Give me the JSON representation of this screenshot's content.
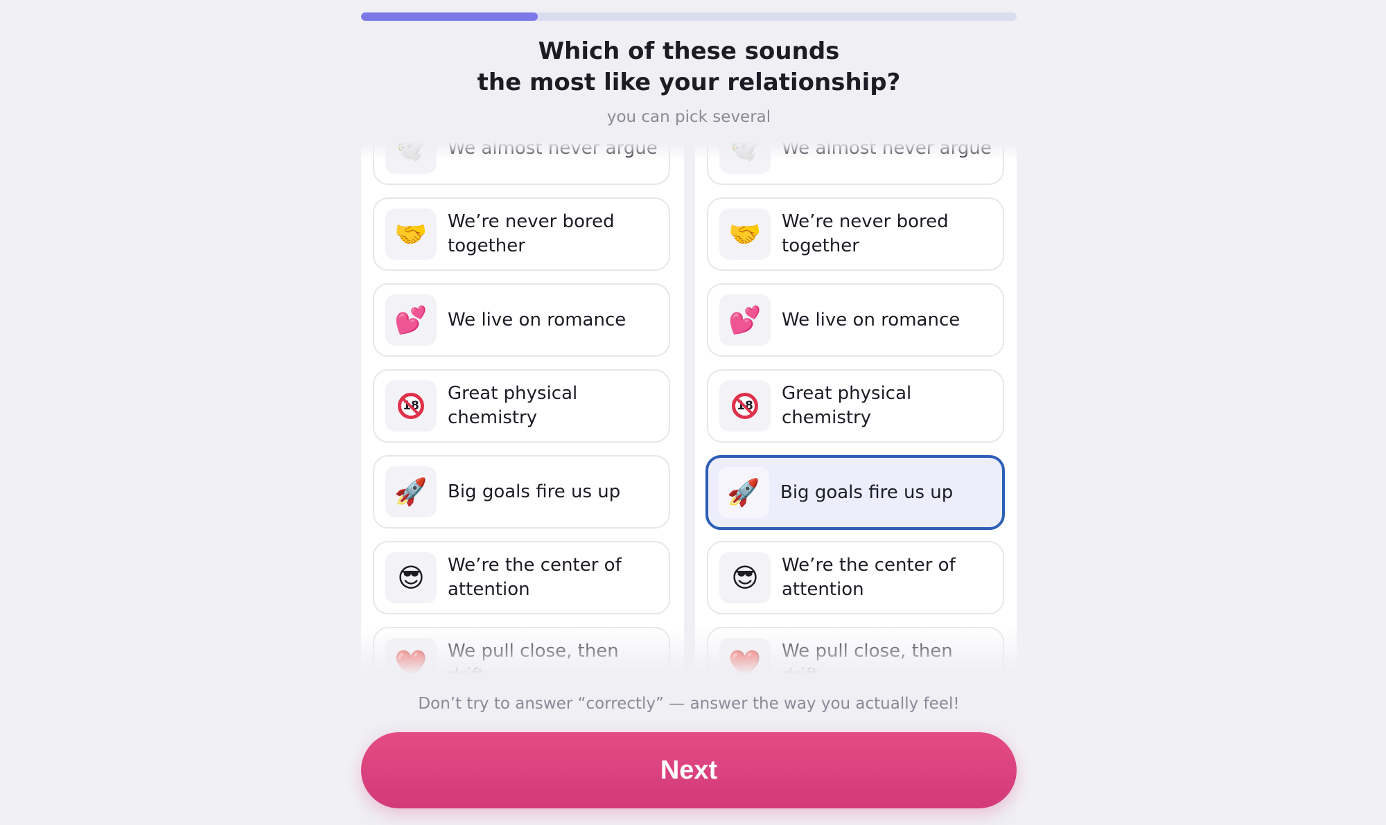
{
  "progress": {
    "fraction": 0.27,
    "fill_color": "#7b78e8",
    "track_color": "#dcdcf1"
  },
  "question": {
    "title_line1": "Which of these sounds",
    "title_line2": "the most like your relationship?",
    "subtitle": "you can pick several"
  },
  "columns": [
    {
      "options": [
        {
          "icon": "dove-icon",
          "glyph": "🕊️",
          "label": "We almost never argue",
          "selected": false
        },
        {
          "icon": "handshake-icon",
          "glyph": "🤝",
          "label": "We’re never bored together",
          "selected": false
        },
        {
          "icon": "two-hearts-icon",
          "glyph": "💕",
          "label": "We live on romance",
          "selected": false
        },
        {
          "icon": "no-under-18-icon",
          "glyph": "18",
          "label": "Great physical chemistry",
          "selected": false
        },
        {
          "icon": "rocket-icon",
          "glyph": "🚀",
          "label": "Big goals fire us up",
          "selected": false
        },
        {
          "icon": "sunglasses-face-icon",
          "glyph": "😎",
          "label": "We’re the center of attention",
          "selected": false
        },
        {
          "icon": "heart-icon",
          "glyph": "❤️",
          "label": "We pull close, then drift",
          "selected": false
        }
      ]
    },
    {
      "options": [
        {
          "icon": "dove-icon",
          "glyph": "🕊️",
          "label": "We almost never argue",
          "selected": false
        },
        {
          "icon": "handshake-icon",
          "glyph": "🤝",
          "label": "We’re never bored together",
          "selected": false
        },
        {
          "icon": "two-hearts-icon",
          "glyph": "💕",
          "label": "We live on romance",
          "selected": false
        },
        {
          "icon": "no-under-18-icon",
          "glyph": "18",
          "label": "Great physical chemistry",
          "selected": false
        },
        {
          "icon": "rocket-icon",
          "glyph": "🚀",
          "label": "Big goals fire us up",
          "selected": true
        },
        {
          "icon": "sunglasses-face-icon",
          "glyph": "😎",
          "label": "We’re the center of attention",
          "selected": false
        },
        {
          "icon": "heart-icon",
          "glyph": "❤️",
          "label": "We pull close, then drift",
          "selected": false
        }
      ]
    }
  ],
  "hint": "Don’t try to answer “correctly” — answer the way you actually feel!",
  "next_button": {
    "label": "Next",
    "color": "#d9407d"
  },
  "selected_border_color": "#2c5fb5"
}
